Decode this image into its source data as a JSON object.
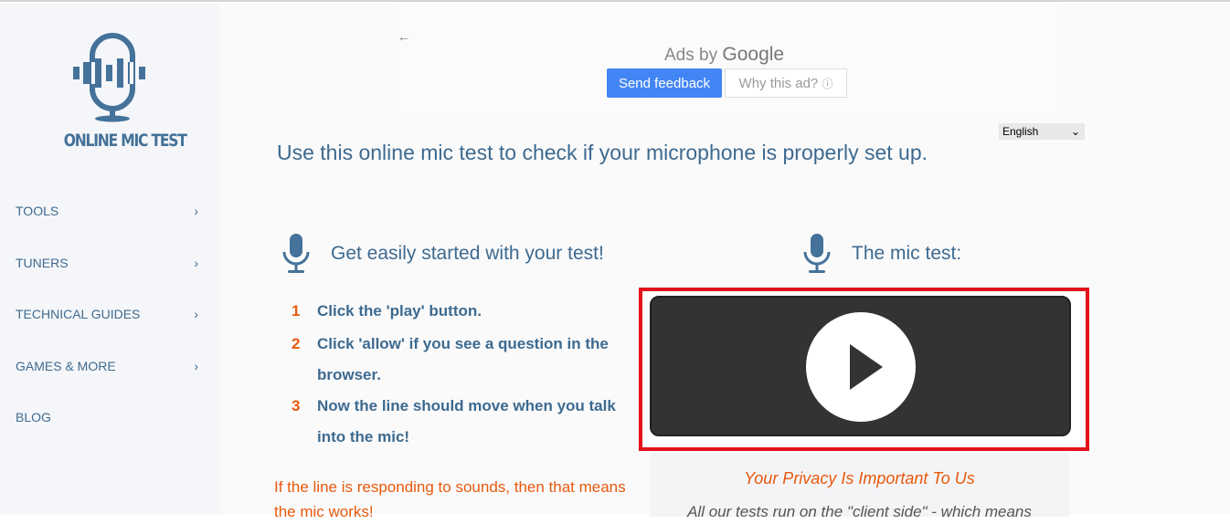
{
  "logo": {
    "text": "ONLINE MIC TEST"
  },
  "nav": [
    {
      "label": "TOOLS",
      "chevron": true
    },
    {
      "label": "TUNERS",
      "chevron": true
    },
    {
      "label": "TECHNICAL GUIDES",
      "chevron": true
    },
    {
      "label": "GAMES & MORE",
      "chevron": true
    },
    {
      "label": "BLOG",
      "chevron": false
    }
  ],
  "ad": {
    "back": "←",
    "ads_by": "Ads by",
    "google": "Google",
    "send_feedback": "Send feedback",
    "why": "Why this ad?",
    "info": "ⓘ"
  },
  "language": {
    "selected": "English"
  },
  "headline": "Use this online mic test to check if your microphone is properly set up.",
  "started": {
    "title": "Get easily started with your test!",
    "steps": [
      {
        "n": "1",
        "text": "Click the 'play' button."
      },
      {
        "n": "2",
        "text": "Click 'allow' if you see a question in the browser."
      },
      {
        "n": "3",
        "text": "Now the line should move when you talk into the mic!"
      }
    ]
  },
  "note": "If the line is responding to sounds, then that means the mic works!",
  "mictest": {
    "title": "The mic test:"
  },
  "privacy": {
    "title": "Your Privacy Is Important To Us",
    "body": "All our tests run on the \"client side\" - which means"
  },
  "colors": {
    "brand": "#3d6a8f",
    "accent": "#e8590c",
    "highlight": "#e3121b"
  }
}
